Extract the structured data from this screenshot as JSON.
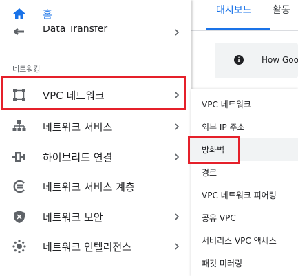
{
  "nav": {
    "home_label": "홈",
    "data_transfer_label": "Data Transfer",
    "section_label": "네트워킹",
    "items": [
      {
        "label": "VPC 네트워크",
        "icon": "vpc-network-icon"
      },
      {
        "label": "네트워크 서비스",
        "icon": "network-services-icon"
      },
      {
        "label": "하이브리드 연결",
        "icon": "hybrid-connectivity-icon"
      },
      {
        "label": "네트워크 서비스 계층",
        "icon": "network-service-tiers-icon"
      },
      {
        "label": "네트워크 보안",
        "icon": "network-security-icon"
      },
      {
        "label": "네트워크 인텔리전스",
        "icon": "network-intelligence-icon"
      }
    ]
  },
  "topbar": {
    "tab_dashboard": "대시보드",
    "tab_activity": "활동"
  },
  "banner": {
    "text": "How Goo"
  },
  "submenu": {
    "items": [
      "VPC 네트워크",
      "외부 IP 주소",
      "방화벽",
      "경로",
      "VPC 네트워크 피어링",
      "공유 VPC",
      "서버리스 VPC 액세스",
      "패킷 미러링"
    ]
  },
  "colors": {
    "accent": "#1a73e8",
    "highlight": "#e5202a",
    "icon_gray": "#5f6368",
    "hover_bg": "#f1f3f4"
  }
}
